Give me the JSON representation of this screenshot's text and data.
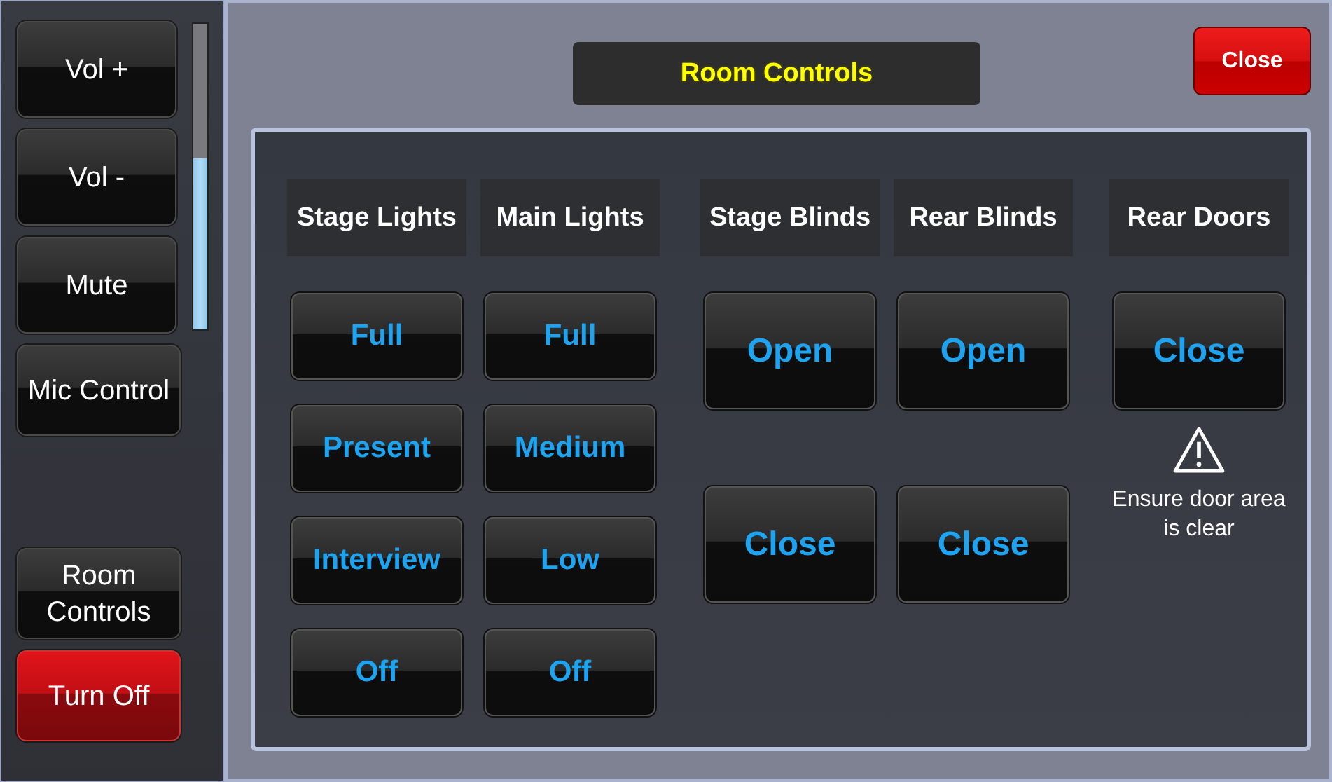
{
  "sidebar": {
    "buttons": [
      {
        "label": "Vol +",
        "kind": "normal"
      },
      {
        "label": "Vol -",
        "kind": "normal"
      },
      {
        "label": "Mute",
        "kind": "normal"
      },
      {
        "label": "Mic Control",
        "kind": "normal"
      },
      {
        "label": "Room Controls",
        "kind": "normal"
      },
      {
        "label": "Turn Off",
        "kind": "danger"
      }
    ],
    "volume": {
      "level": 0.56
    }
  },
  "title": "Room Controls",
  "close_button": "Close",
  "columns": [
    {
      "heading": "Stage Lights",
      "kind": "lights",
      "buttons": [
        "Full",
        "Present",
        "Interview",
        "Off"
      ]
    },
    {
      "heading": "Main Lights",
      "kind": "lights",
      "buttons": [
        "Full",
        "Medium",
        "Low",
        "Off"
      ]
    },
    {
      "heading": "Stage Blinds",
      "kind": "blinds",
      "buttons": [
        "Open",
        "Close"
      ]
    },
    {
      "heading": "Rear Blinds",
      "kind": "blinds",
      "buttons": [
        "Open",
        "Close"
      ]
    },
    {
      "heading": "Rear Doors",
      "kind": "doors",
      "buttons": [
        "Close"
      ],
      "warning": "Ensure door area is clear"
    }
  ]
}
